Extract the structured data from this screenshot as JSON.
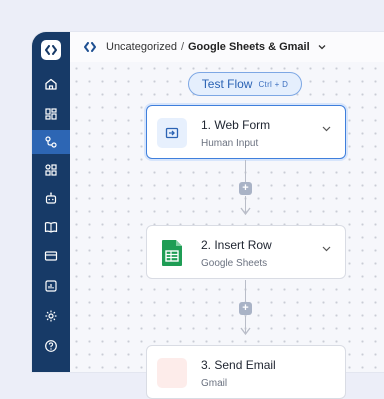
{
  "breadcrumb": {
    "folder": "Uncategorized",
    "separator": "/",
    "current": "Google Sheets & Gmail"
  },
  "test_flow": {
    "label": "Test Flow",
    "shortcut": "Ctrl + D"
  },
  "steps": [
    {
      "title": "1. Web Form",
      "subtitle": "Human Input",
      "icon": "web-form-icon"
    },
    {
      "title": "2. Insert Row",
      "subtitle": "Google Sheets",
      "icon": "google-sheets-icon"
    },
    {
      "title": "3. Send Email",
      "subtitle": "Gmail",
      "icon": "gmail-icon"
    }
  ],
  "sidebar": {
    "items": [
      "home-icon",
      "dashboard-icon",
      "workflows-icon",
      "apps-icon",
      "bot-icon",
      "docs-icon",
      "billing-icon",
      "reports-icon",
      "settings-icon",
      "help-icon"
    ],
    "active": "workflows-icon"
  },
  "colors": {
    "sidebar": "#173a67",
    "accent": "#3f7fdc",
    "sheets_green": "#1f9d55"
  }
}
